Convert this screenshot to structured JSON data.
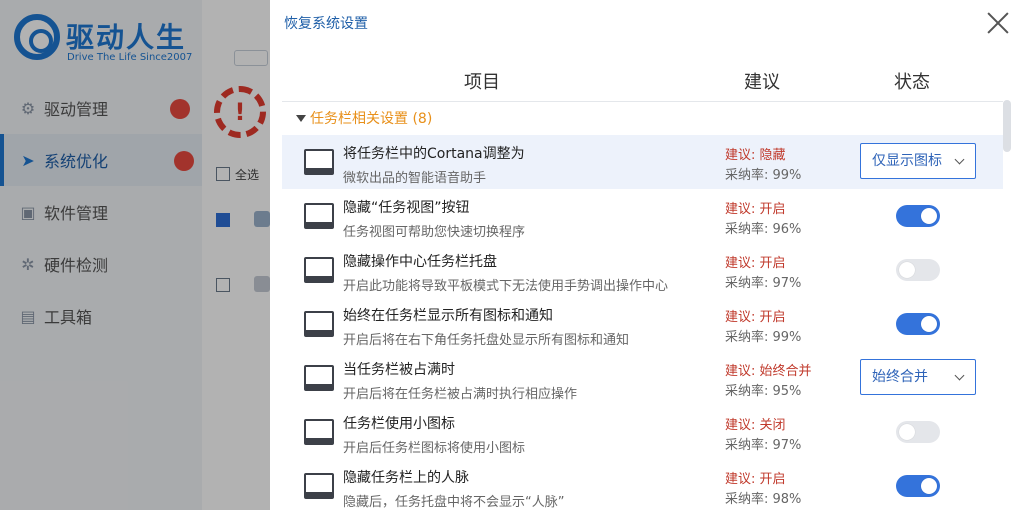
{
  "app": {
    "logo_name": "驱动人生",
    "logo_sub": "Drive The Life  Since2007",
    "nav": [
      {
        "label": "驱动管理",
        "icon": "gear-icon"
      },
      {
        "label": "系统优化",
        "icon": "rocket-icon"
      },
      {
        "label": "软件管理",
        "icon": "briefcase-icon"
      },
      {
        "label": "硬件检测",
        "icon": "chip-icon"
      },
      {
        "label": "工具箱",
        "icon": "toolbox-icon"
      }
    ],
    "select_all": "全选"
  },
  "dialog": {
    "title": "恢复系统设置",
    "columns": {
      "item": "项目",
      "suggestion": "建议",
      "status": "状态"
    },
    "group": {
      "label": "任务栏相关设置 (8)"
    },
    "rows": [
      {
        "title": "将任务栏中的Cortana调整为",
        "desc": "微软出品的智能语音助手",
        "suggestion": "建议: 隐藏",
        "rate": "采纳率: 99%",
        "control": "select",
        "value": "仅显示图标"
      },
      {
        "title": "隐藏“任务视图”按钮",
        "desc": "任务视图可帮助您快速切换程序",
        "suggestion": "建议: 开启",
        "rate": "采纳率: 96%",
        "control": "toggle",
        "on": true
      },
      {
        "title": "隐藏操作中心任务栏托盘",
        "desc": "开启此功能将导致平板模式下无法使用手势调出操作中心",
        "suggestion": "建议: 开启",
        "rate": "采纳率: 97%",
        "control": "toggle",
        "on": false
      },
      {
        "title": "始终在任务栏显示所有图标和通知",
        "desc": "开启后将在右下角任务托盘处显示所有图标和通知",
        "suggestion": "建议: 开启",
        "rate": "采纳率: 99%",
        "control": "toggle",
        "on": true
      },
      {
        "title": "当任务栏被占满时",
        "desc": "开启后将在任务栏被占满时执行相应操作",
        "suggestion": "建议: 始终合并",
        "rate": "采纳率: 95%",
        "control": "select",
        "value": "始终合并"
      },
      {
        "title": "任务栏使用小图标",
        "desc": "开启后任务栏图标将使用小图标",
        "suggestion": "建议: 关闭",
        "rate": "采纳率: 97%",
        "control": "toggle",
        "on": false
      },
      {
        "title": "隐藏任务栏上的人脉",
        "desc": "隐藏后，任务托盘中将不会显示“人脉”",
        "suggestion": "建议: 开启",
        "rate": "采纳率: 98%",
        "control": "toggle",
        "on": true
      }
    ]
  },
  "colors": {
    "accent": "#3473db",
    "suggestion": "#c0392b",
    "group": "#e8901a"
  }
}
